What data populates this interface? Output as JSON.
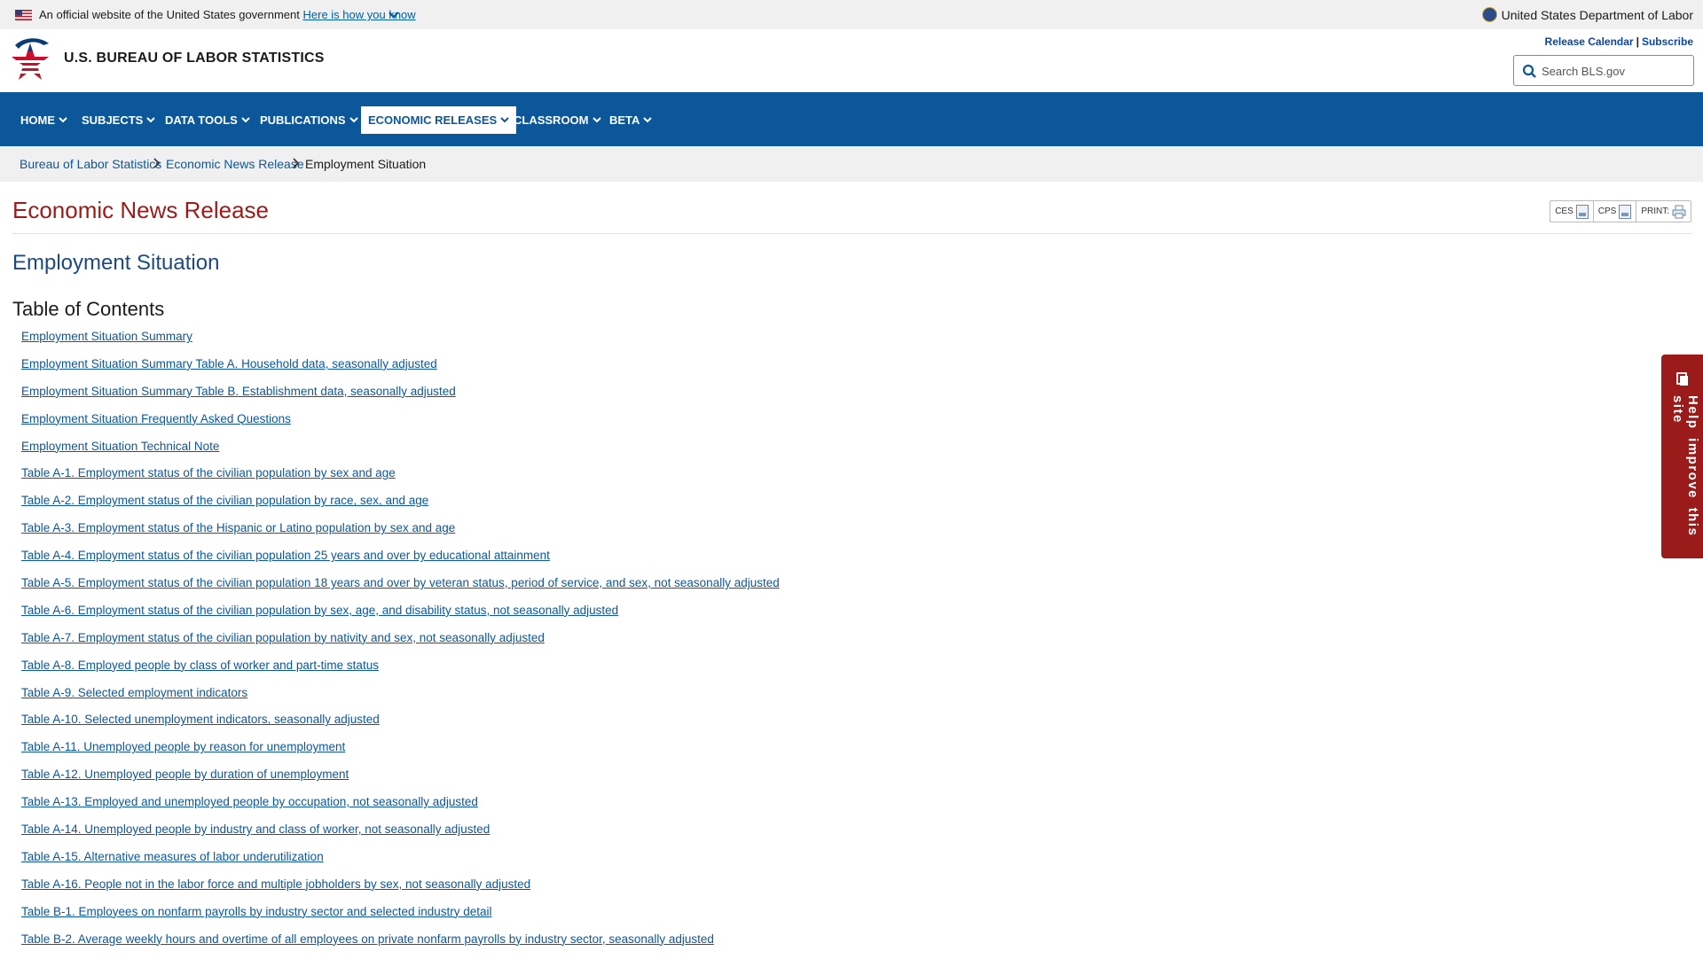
{
  "gov_banner": {
    "official_text": "An official website of the United States government",
    "how_link": "Here is how you know",
    "department": "United States Department of Labor"
  },
  "header": {
    "title": "U.S. BUREAU OF LABOR STATISTICS",
    "release_calendar": "Release Calendar",
    "separator": "|",
    "subscribe": "Subscribe",
    "search_placeholder": "Search BLS.gov"
  },
  "nav": {
    "items": [
      {
        "label": "HOME",
        "active": false
      },
      {
        "label": "SUBJECTS",
        "active": false
      },
      {
        "label": "DATA TOOLS",
        "active": false
      },
      {
        "label": "PUBLICATIONS",
        "active": false
      },
      {
        "label": "ECONOMIC RELEASES",
        "active": true
      },
      {
        "label": "CLASSROOM",
        "active": false
      },
      {
        "label": "BETA",
        "active": false
      }
    ]
  },
  "breadcrumb": [
    "Bureau of Labor Statistics",
    "Economic News Release",
    "Employment Situation"
  ],
  "page": {
    "release_title": "Economic News Release",
    "tools": [
      "CES",
      "CPS",
      "PRINT:"
    ],
    "release_name": "Employment Situation",
    "toc_title": "Table of Contents",
    "toc": [
      "Employment Situation Summary",
      "Employment Situation Summary Table A. Household data, seasonally adjusted",
      "Employment Situation Summary Table B. Establishment data, seasonally adjusted",
      "Employment Situation Frequently Asked Questions",
      "Employment Situation Technical Note",
      "Table A-1. Employment status of the civilian population by sex and age",
      "Table A-2. Employment status of the civilian population by race, sex, and age",
      "Table A-3. Employment status of the Hispanic or Latino population by sex and age",
      "Table A-4. Employment status of the civilian population 25 years and over by educational attainment",
      "Table A-5. Employment status of the civilian population 18 years and over by veteran status, period of service, and sex, not seasonally adjusted",
      "Table A-6. Employment status of the civilian population by sex, age, and disability status, not seasonally adjusted",
      "Table A-7. Employment status of the civilian population by nativity and sex, not seasonally adjusted",
      "Table A-8. Employed people by class of worker and part-time status",
      "Table A-9. Selected employment indicators",
      "Table A-10. Selected unemployment indicators, seasonally adjusted",
      "Table A-11. Unemployed people by reason for unemployment",
      "Table A-12. Unemployed people by duration of unemployment",
      "Table A-13. Employed and unemployed people by occupation, not seasonally adjusted",
      "Table A-14. Unemployed people by industry and class of worker, not seasonally adjusted",
      "Table A-15. Alternative measures of labor underutilization",
      "Table A-16. People not in the labor force and multiple jobholders by sex, not seasonally adjusted",
      "Table B-1. Employees on nonfarm payrolls by industry sector and selected industry detail",
      "Table B-2. Average weekly hours and overtime of all employees on private nonfarm payrolls by industry sector, seasonally adjusted"
    ]
  },
  "feedback": {
    "label": "Help improve this site"
  },
  "colors": {
    "nav_blue": "#0c5799",
    "title_red": "#9b1b1b",
    "link_blue": "#0c5799",
    "heading_blue": "#1c4a80"
  }
}
